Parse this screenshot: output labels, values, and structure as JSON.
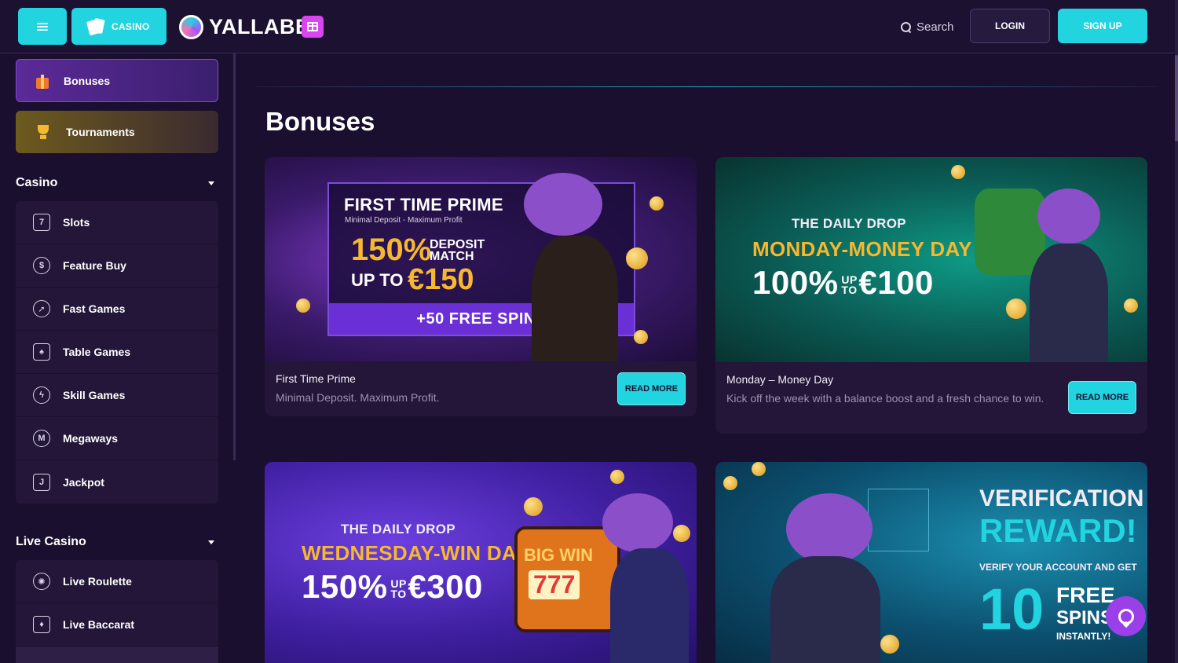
{
  "header": {
    "casino_label": "CASINO",
    "logo_text": "YALLABET",
    "search_label": "Search",
    "login_label": "LOGIN",
    "signup_label": "SIGN UP"
  },
  "sidebar": {
    "promos": [
      {
        "label": "Bonuses",
        "icon": "gift-icon"
      },
      {
        "label": "Tournaments",
        "icon": "trophy-icon"
      }
    ],
    "casino": {
      "title": "Casino",
      "items": [
        {
          "label": "Slots",
          "icon": "slot-seven-icon"
        },
        {
          "label": "Feature Buy",
          "icon": "coin-icon"
        },
        {
          "label": "Fast Games",
          "icon": "rocket-icon"
        },
        {
          "label": "Table Games",
          "icon": "cards-icon"
        },
        {
          "label": "Skill Games",
          "icon": "lightning-icon"
        },
        {
          "label": "Megaways",
          "icon": "megaways-icon"
        },
        {
          "label": "Jackpot",
          "icon": "jackpot-icon"
        }
      ]
    },
    "live_casino": {
      "title": "Live Casino",
      "items": [
        {
          "label": "Live Roulette",
          "icon": "roulette-icon"
        },
        {
          "label": "Live Baccarat",
          "icon": "baccarat-icon"
        }
      ]
    }
  },
  "main": {
    "title": "Bonuses",
    "read_more_label": "READ MORE",
    "cards": [
      {
        "title": "First Time Prime",
        "description": "Minimal Deposit. Maximum Profit.",
        "banner": {
          "headline": "FIRST TIME PRIME",
          "sub": "Minimal Deposit - Maximum Profit",
          "percent": "150%",
          "match": "DEPOSIT MATCH",
          "upto": "UP TO",
          "amount": "€150",
          "spins": "+50 FREE SPINS"
        }
      },
      {
        "title": "Monday – Money Day",
        "description": "Kick off the week with a balance boost and a fresh chance to win.",
        "banner": {
          "head": "THE DAILY DROP",
          "day": "MONDAY-MONEY DAY",
          "percent": "100%",
          "upto": "UP TO",
          "amount": "€100"
        }
      },
      {
        "banner": {
          "head": "THE DAILY DROP",
          "day": "WEDNESDAY-WIN DAY",
          "percent": "150%",
          "upto": "UP TO",
          "amount": "€300",
          "big_win": "BIG WIN",
          "reels": "777"
        }
      },
      {
        "banner": {
          "line1": "VERIFICATION",
          "line2": "REWARD!",
          "line3": "VERIFY YOUR ACCOUNT AND GET",
          "number": "10",
          "free": "FREE",
          "spins": "SPINS",
          "instantly": "INSTANTLY!"
        }
      }
    ]
  },
  "colors": {
    "accent": "#22d3e0",
    "background": "#1a0f2e",
    "card": "#231638",
    "gold": "#f5b82e",
    "purple": "#7c4dd6"
  }
}
